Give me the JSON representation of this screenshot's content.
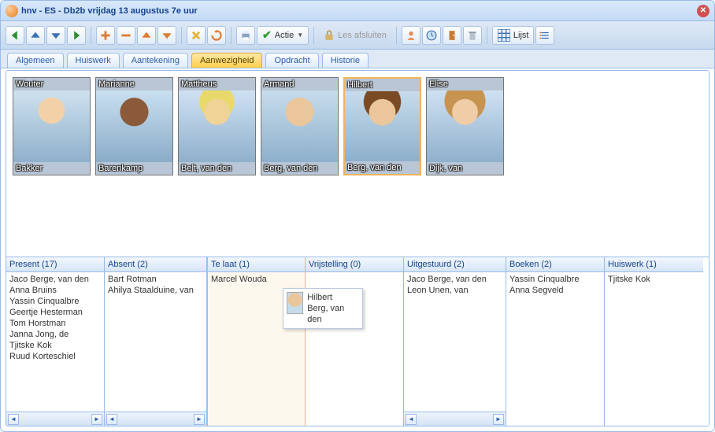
{
  "window": {
    "title": "hnv - ES - Db2b vrijdag 13 augustus 7e uur"
  },
  "toolbar": {
    "actie_label": "Actie",
    "les_afsluiten_label": "Les afsluiten",
    "lijst_label": "Lijst"
  },
  "tabs": {
    "items": [
      {
        "label": "Algemeen"
      },
      {
        "label": "Huiswerk"
      },
      {
        "label": "Aantekening"
      },
      {
        "label": "Aanwezigheid"
      },
      {
        "label": "Opdracht"
      },
      {
        "label": "Historie"
      }
    ],
    "active_index": 3
  },
  "students": [
    {
      "first": "Wouter",
      "last": "Bakker"
    },
    {
      "first": "Marianne",
      "last": "Barenkamp"
    },
    {
      "first": "Mattheus",
      "last": "Belt, van den"
    },
    {
      "first": "Armand",
      "last": "Berg, van den"
    },
    {
      "first": "Hilbert",
      "last": "Berg, van den",
      "selected": true
    },
    {
      "first": "Elise",
      "last": "Dijk, van"
    }
  ],
  "columns": {
    "present": {
      "header": "Present (17)",
      "items": [
        "Jaco  Berge, van den",
        "Anna  Bruins",
        "Yassin Cinqualbre",
        "Geertje  Hesterman",
        "Tom Horstman",
        "Janna  Jong, de",
        "Tjitske  Kok",
        "Ruud  Korteschiel"
      ]
    },
    "absent": {
      "header": "Absent (2)",
      "items": [
        "Bart Rotman",
        "Ahilya  Staalduine, van"
      ]
    },
    "telaat": {
      "header": "Te laat (1)",
      "items": [
        "Marcel  Wouda"
      ]
    },
    "vrijstelling": {
      "header": "Vrijstelling (0)",
      "items": []
    },
    "uitgestuurd": {
      "header": "Uitgestuurd (2)",
      "items": [
        "Jaco  Berge, van den",
        "Leon Unen, van"
      ]
    },
    "boeken": {
      "header": "Boeken (2)",
      "items": [
        "Yassin Cinqualbre",
        "Anna  Segveld"
      ]
    },
    "huiswerk": {
      "header": "Huiswerk (1)",
      "items": [
        "Tjitske  Kok"
      ]
    }
  },
  "tooltip": {
    "first": "Hilbert",
    "last": "Berg, van den"
  }
}
